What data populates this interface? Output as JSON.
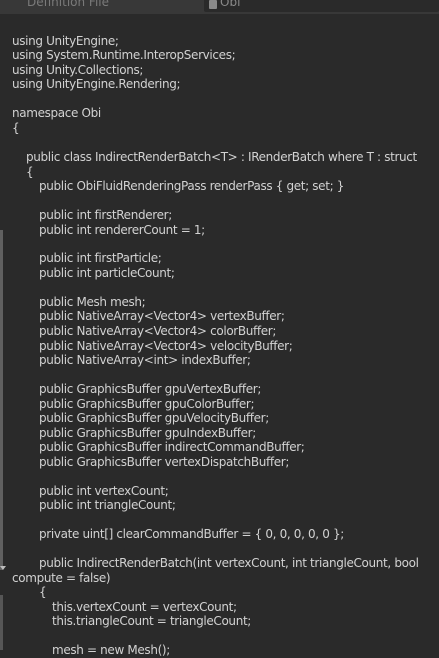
{
  "header": {
    "label": "Definition File",
    "value": "Obi",
    "value_icon": "file-icon"
  },
  "code_lines": [
    "using UnityEngine;",
    "using System.Runtime.InteropServices;",
    "using Unity.Collections;",
    "using UnityEngine.Rendering;",
    "namespace Obi",
    "{",
    "public class IndirectRenderBatch<T> : IRenderBatch where T : struct",
    "{",
    "public ObiFluidRenderingPass renderPass { get; set; }",
    "public int firstRenderer;",
    "public int rendererCount = 1;",
    "public int firstParticle;",
    "public int particleCount;",
    "public Mesh mesh;",
    "public NativeArray<Vector4> vertexBuffer;",
    "public NativeArray<Vector4> colorBuffer;",
    "public NativeArray<Vector4> velocityBuffer;",
    "public NativeArray<int> indexBuffer;",
    "public GraphicsBuffer gpuVertexBuffer;",
    "public GraphicsBuffer gpuColorBuffer;",
    "public GraphicsBuffer gpuVelocityBuffer;",
    "public GraphicsBuffer gpuIndexBuffer;",
    "public GraphicsBuffer indirectCommandBuffer;",
    "public GraphicsBuffer vertexDispatchBuffer;",
    "public int vertexCount;",
    "public int triangleCount;",
    "private uint[] clearCommandBuffer = { 0, 0, 0, 0, 0 };",
    "public IndirectRenderBatch(int vertexCount, int triangleCount, bool",
    "compute = false)",
    "{",
    "this.vertexCount = vertexCount;",
    "this.triangleCount = triangleCount;",
    "mesh = new Mesh();"
  ]
}
